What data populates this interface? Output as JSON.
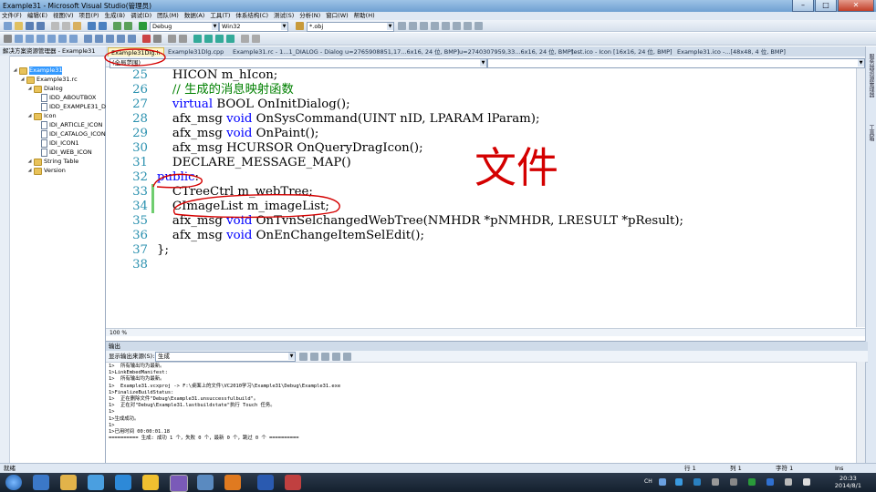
{
  "window": {
    "title": "Example31 - Microsoft Visual Studio(管理员)",
    "minimize": "–",
    "maximize": "□",
    "close": "✕"
  },
  "menu": [
    "文件(F)",
    "编辑(E)",
    "视图(V)",
    "项目(P)",
    "生成(B)",
    "调试(D)",
    "团队(M)",
    "数据(A)",
    "工具(T)",
    "体系结构(C)",
    "测试(S)",
    "分析(N)",
    "窗口(W)",
    "帮助(H)"
  ],
  "toolbar": {
    "config": "Debug",
    "platform": "Win32",
    "find": "*.obj"
  },
  "solution_explorer": {
    "title": "解决方案资源管理器 - Example31",
    "tree": [
      {
        "label": "Example31",
        "kind": "root",
        "sel": true
      },
      {
        "label": "Example31.rc",
        "kind": "folder"
      },
      {
        "label": "Dialog",
        "kind": "folder"
      },
      {
        "label": "IDD_ABOUTBOX",
        "kind": "file"
      },
      {
        "label": "IDD_EXAMPLE31_DIALOG",
        "kind": "file"
      },
      {
        "label": "Icon",
        "kind": "folder"
      },
      {
        "label": "IDI_ARTICLE_ICON",
        "kind": "file"
      },
      {
        "label": "IDI_CATALOG_ICON",
        "kind": "file"
      },
      {
        "label": "IDI_ICON1",
        "kind": "file"
      },
      {
        "label": "IDI_WEB_ICON",
        "kind": "file"
      },
      {
        "label": "String Table",
        "kind": "folder"
      },
      {
        "label": "Version",
        "kind": "folder"
      }
    ]
  },
  "tabs": [
    "Example31Dlg.h",
    "Example31Dlg.cpp",
    "Example31.rc - 1...1_DIALOG - Dialog",
    "u=2765908851,17...6x16, 24 位, BMP]",
    "u=2740307959,33...6x16, 24 位, BMP]",
    "test.ico - Icon [16x16, 24 位, BMP]",
    "Example31.ico -...[48x48, 4 位, BMP]"
  ],
  "scope": "(全局范围)",
  "code": [
    {
      "n": "25",
      "parts": [
        [
          "t",
          "    HICON m_hIcon;"
        ]
      ]
    },
    {
      "n": "26",
      "parts": [
        [
          "c",
          "    // 生成的消息映射函数"
        ]
      ]
    },
    {
      "n": "27",
      "parts": [
        [
          "k",
          "    virtual"
        ],
        [
          "t",
          " BOOL OnInitDialog();"
        ]
      ]
    },
    {
      "n": "28",
      "parts": [
        [
          "t",
          "    afx_msg "
        ],
        [
          "k",
          "void"
        ],
        [
          "t",
          " OnSysCommand(UINT nID, LPARAM lParam);"
        ]
      ]
    },
    {
      "n": "29",
      "parts": [
        [
          "t",
          "    afx_msg "
        ],
        [
          "k",
          "void"
        ],
        [
          "t",
          " OnPaint();"
        ]
      ]
    },
    {
      "n": "30",
      "parts": [
        [
          "t",
          "    afx_msg HCURSOR OnQueryDragIcon();"
        ]
      ]
    },
    {
      "n": "31",
      "parts": [
        [
          "t",
          "    DECLARE_MESSAGE_MAP()"
        ]
      ]
    },
    {
      "n": "32",
      "parts": [
        [
          "k",
          "public"
        ],
        [
          "t",
          ":"
        ]
      ]
    },
    {
      "n": "33",
      "parts": [
        [
          "t",
          "    CTreeCtrl m_webTree;"
        ]
      ]
    },
    {
      "n": "34",
      "parts": [
        [
          "t",
          "    CImageList m_imageList;"
        ]
      ]
    },
    {
      "n": "35",
      "parts": [
        [
          "t",
          "    afx_msg "
        ],
        [
          "k",
          "void"
        ],
        [
          "t",
          " OnTvnSelchangedWebTree(NMHDR *pNMHDR, LRESULT *pResult);"
        ]
      ]
    },
    {
      "n": "36",
      "parts": [
        [
          "t",
          "    afx_msg "
        ],
        [
          "k",
          "void"
        ],
        [
          "t",
          " OnEnChangeItemSelEdit();"
        ]
      ]
    },
    {
      "n": "37",
      "parts": [
        [
          "t",
          "};"
        ]
      ]
    },
    {
      "n": "38",
      "parts": [
        [
          "t",
          ""
        ]
      ]
    }
  ],
  "handwriting": "文件",
  "zoom": "100 %",
  "output": {
    "title": "输出",
    "show_label": "显示输出来源(S):",
    "source": "生成",
    "lines": [
      "1>  所有输出均为最新。",
      "1>LinkEmbedManifest:",
      "1>  所有输出均为最新。",
      "1>  Example31.vcxproj -> F:\\桌面上的文件\\VC2010学习\\Example31\\Debug\\Example31.exe",
      "1>FinalizeBuildStatus:",
      "1>  正在删除文件\"Debug\\Example31.unsuccessfulbuild\"。",
      "1>  正在对\"Debug\\Example31.lastbuildstate\"执行 Touch 任务。",
      "1>",
      "1>生成成功。",
      "1>",
      "1>已用时间 00:00:01.18",
      "========== 生成: 成功 1 个，失败 0 个，最新 0 个，跳过 0 个 =========="
    ]
  },
  "status": {
    "ready": "就绪",
    "line": "行 1",
    "col": "列 1",
    "ch": "字符 1",
    "ins": "Ins"
  },
  "right_strip": [
    "服务器资源管理器",
    "工具箱"
  ],
  "taskbar": {
    "lang": "CH",
    "time": "20:33",
    "date": "2014/8/1"
  },
  "colors": {
    "keyword": "#0000ff",
    "comment": "#008000",
    "linenum": "#2b91af",
    "annotation": "#d40000"
  }
}
